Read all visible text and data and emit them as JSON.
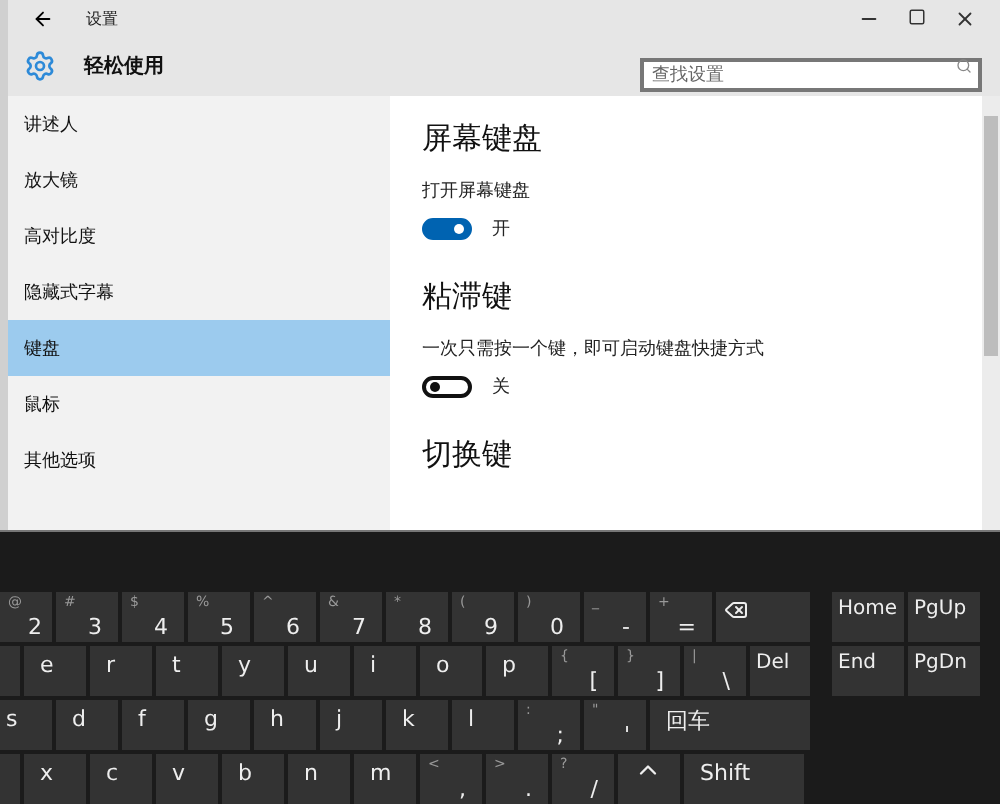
{
  "settings_window": {
    "title": "设置",
    "section_title": "轻松使用",
    "search": {
      "placeholder": "查找设置"
    },
    "sidebar": {
      "items": [
        {
          "label": "讲述人",
          "selected": false
        },
        {
          "label": "放大镜",
          "selected": false
        },
        {
          "label": "高对比度",
          "selected": false
        },
        {
          "label": "隐藏式字幕",
          "selected": false
        },
        {
          "label": "键盘",
          "selected": true
        },
        {
          "label": "鼠标",
          "selected": false
        },
        {
          "label": "其他选项",
          "selected": false
        }
      ]
    },
    "sections": [
      {
        "heading": "屏幕键盘",
        "description": "打开屏幕键盘",
        "toggle": {
          "on": true,
          "state_label": "开"
        }
      },
      {
        "heading": "粘滞键",
        "description": "一次只需按一个键，即可启动键盘快捷方式",
        "toggle": {
          "on": false,
          "state_label": "关"
        }
      },
      {
        "heading": "切换键"
      }
    ]
  },
  "keyboard": {
    "rows": [
      [
        {
          "kind": "edge",
          "main": "2",
          "shift": "@"
        },
        {
          "kind": "symbol",
          "main": "3",
          "shift": "#"
        },
        {
          "kind": "symbol",
          "main": "4",
          "shift": "$"
        },
        {
          "kind": "symbol",
          "main": "5",
          "shift": "%"
        },
        {
          "kind": "symbol",
          "main": "6",
          "shift": "^"
        },
        {
          "kind": "symbol",
          "main": "7",
          "shift": "&"
        },
        {
          "kind": "symbol",
          "main": "8",
          "shift": "*"
        },
        {
          "kind": "symbol",
          "main": "9",
          "shift": "("
        },
        {
          "kind": "symbol",
          "main": "0",
          "shift": ")"
        },
        {
          "kind": "symbol",
          "main": "-",
          "shift": "_"
        },
        {
          "kind": "symbol",
          "main": "=",
          "shift": "+"
        },
        {
          "kind": "backspace"
        }
      ],
      [
        {
          "kind": "stub"
        },
        {
          "kind": "letter",
          "main": "e"
        },
        {
          "kind": "letter",
          "main": "r"
        },
        {
          "kind": "letter",
          "main": "t"
        },
        {
          "kind": "letter",
          "main": "y"
        },
        {
          "kind": "letter",
          "main": "u"
        },
        {
          "kind": "letter",
          "main": "i"
        },
        {
          "kind": "letter",
          "main": "o"
        },
        {
          "kind": "letter",
          "main": "p"
        },
        {
          "kind": "symbol",
          "main": "[",
          "shift": "{"
        },
        {
          "kind": "symbol",
          "main": "]",
          "shift": "}"
        },
        {
          "kind": "symbol",
          "main": "\\",
          "shift": "|"
        },
        {
          "kind": "function",
          "main": "Del"
        }
      ],
      [
        {
          "kind": "edge",
          "main": "s"
        },
        {
          "kind": "letter",
          "main": "d"
        },
        {
          "kind": "letter",
          "main": "f"
        },
        {
          "kind": "letter",
          "main": "g"
        },
        {
          "kind": "letter",
          "main": "h"
        },
        {
          "kind": "letter",
          "main": "j"
        },
        {
          "kind": "letter",
          "main": "k"
        },
        {
          "kind": "letter",
          "main": "l"
        },
        {
          "kind": "symbol",
          "main": ";",
          "shift": ":"
        },
        {
          "kind": "symbol",
          "main": "'",
          "shift": "\""
        },
        {
          "kind": "enter",
          "main": "回车"
        }
      ],
      [
        {
          "kind": "stub"
        },
        {
          "kind": "letter",
          "main": "x"
        },
        {
          "kind": "letter",
          "main": "c"
        },
        {
          "kind": "letter",
          "main": "v"
        },
        {
          "kind": "letter",
          "main": "b"
        },
        {
          "kind": "letter",
          "main": "n"
        },
        {
          "kind": "letter",
          "main": "m"
        },
        {
          "kind": "symbol",
          "main": ",",
          "shift": "<"
        },
        {
          "kind": "symbol",
          "main": ".",
          "shift": ">"
        },
        {
          "kind": "symbol",
          "main": "/",
          "shift": "?"
        },
        {
          "kind": "arrow"
        },
        {
          "kind": "shiftkey",
          "main": "Shift"
        }
      ]
    ],
    "nav_rows": [
      [
        {
          "kind": "nav",
          "main": "Home"
        },
        {
          "kind": "nav",
          "main": "PgUp"
        }
      ],
      [
        {
          "kind": "nav",
          "main": "End"
        },
        {
          "kind": "nav",
          "main": "PgDn"
        }
      ]
    ]
  }
}
